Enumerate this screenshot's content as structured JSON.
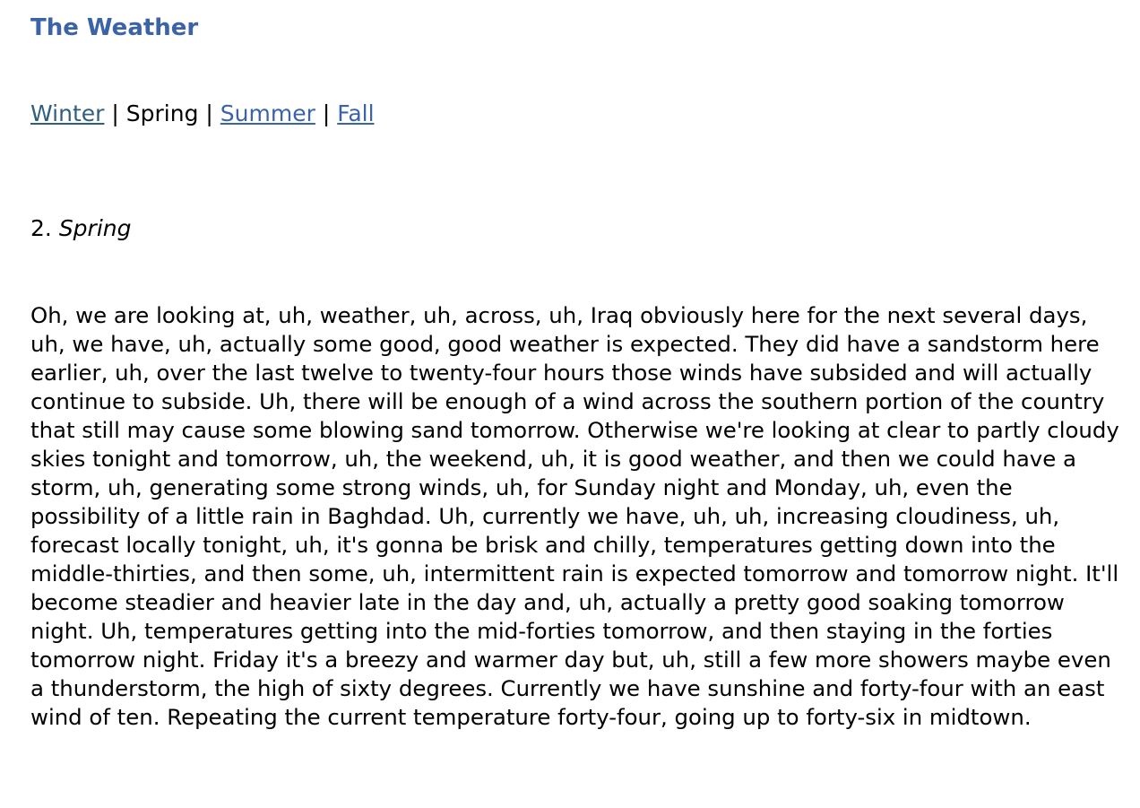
{
  "page": {
    "title": "The Weather",
    "title_color": "#3b63a8"
  },
  "nav": {
    "items": [
      {
        "label": "Winter",
        "state": "visited-link"
      },
      {
        "label": "Spring",
        "state": "current"
      },
      {
        "label": "Summer",
        "state": "link"
      },
      {
        "label": "Fall",
        "state": "link"
      }
    ],
    "separator": "|"
  },
  "section": {
    "number": "2.",
    "name": "Spring"
  },
  "transcript": {
    "text": "Oh, we are looking at, uh, weather, uh, across, uh, Iraq obviously here for the next several days, uh, we have, uh, actually some good, good weather is expected. They did have a sandstorm here earlier, uh, over the last twelve to twenty-four hours those winds have subsided and will actually continue to subside. Uh, there will be enough of a wind across the southern portion of the country that still may cause some blowing sand tomorrow. Otherwise we're looking at clear to partly cloudy skies tonight and tomorrow, uh, the weekend, uh, it is good weather, and then we could have a storm, uh, generating some strong winds, uh, for Sunday night and Monday, uh, even the possibility of a little rain in Baghdad. Uh, currently we have, uh, uh, increasing cloudiness, uh, forecast locally tonight, uh, it's gonna be brisk and chilly, temperatures getting down into the middle-thirties, and then some, uh, intermittent rain is expected tomorrow and tomorrow night. It'll become steadier and heavier late in the day and, uh, actually a pretty good soaking tomorrow night. Uh, temperatures getting into the mid-forties tomorrow, and then staying in the forties tomorrow night. Friday it's a breezy and warmer day but, uh, still a few more showers maybe even a thunderstorm, the high of sixty degrees. Currently we have sunshine and forty-four with an east wind of ten. Repeating the current temperature forty-four, going up to forty-six in midtown."
  }
}
